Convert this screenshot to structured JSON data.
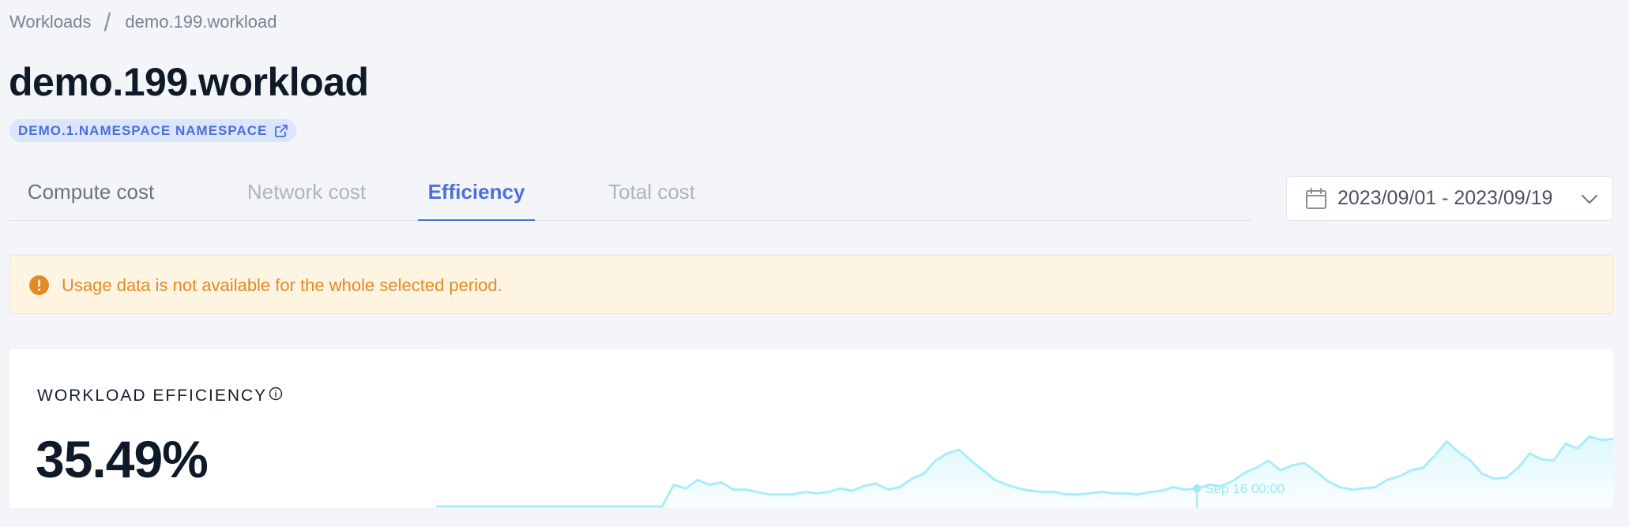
{
  "breadcrumb": {
    "root": "Workloads",
    "separator": "/",
    "current": "demo.199.workload"
  },
  "page": {
    "title": "demo.199.workload",
    "namespace_badge": "DEMO.1.NAMESPACE NAMESPACE",
    "namespace_icon": "external-link-icon"
  },
  "tabs": [
    {
      "label": "Compute cost",
      "active": false
    },
    {
      "label": "Network cost",
      "active": false
    },
    {
      "label": "Efficiency",
      "active": true
    },
    {
      "label": "Total cost",
      "active": false
    }
  ],
  "date_range": {
    "value": "2023/09/01 - 2023/09/19",
    "icon": "calendar-icon",
    "chevron": "chevron-down-icon"
  },
  "warning": {
    "icon": "alert-circle-icon",
    "text": "Usage data is not available for the whole selected period."
  },
  "efficiency": {
    "label": "WORKLOAD EFFICIENCY",
    "info_icon": "info-icon",
    "value": "35.49%"
  },
  "colors": {
    "accent": "#4a70d9",
    "badge_bg": "#dbe5fb",
    "warning_bg": "#fdf4e2",
    "warning_text": "#e48a25",
    "chart_line": "#a9ecfb",
    "chart_fill": "#e6f9fe",
    "background": "#f4f5f9"
  },
  "chart_data": {
    "type": "area",
    "title": "",
    "xlabel": "",
    "ylabel": "",
    "x_range": [
      "Sep 01",
      "Sep 19"
    ],
    "hover_label": "Sep 16 00:00",
    "hover_index": 64,
    "ylim": [
      0,
      100
    ],
    "series": [
      {
        "values": [
          0,
          0,
          0,
          0,
          0,
          0,
          0,
          0,
          0,
          0,
          0,
          0,
          0,
          0,
          0,
          0,
          0,
          0,
          0,
          0,
          18,
          15,
          22,
          18,
          20,
          14,
          14,
          12,
          10,
          10,
          10,
          12,
          11,
          12,
          15,
          13,
          17,
          19,
          14,
          16,
          23,
          27,
          38,
          44,
          47,
          38,
          30,
          22,
          18,
          15,
          13,
          12,
          12,
          10,
          10,
          11,
          12,
          11,
          11,
          10,
          12,
          13,
          16,
          14,
          15,
          18,
          17,
          21,
          28,
          32,
          38,
          30,
          34,
          36,
          29,
          21,
          16,
          14,
          15,
          16,
          22,
          25,
          30,
          32,
          42,
          54,
          45,
          38,
          27,
          23,
          24,
          32,
          44,
          39,
          38,
          52,
          48,
          58,
          55,
          56
        ]
      }
    ]
  }
}
